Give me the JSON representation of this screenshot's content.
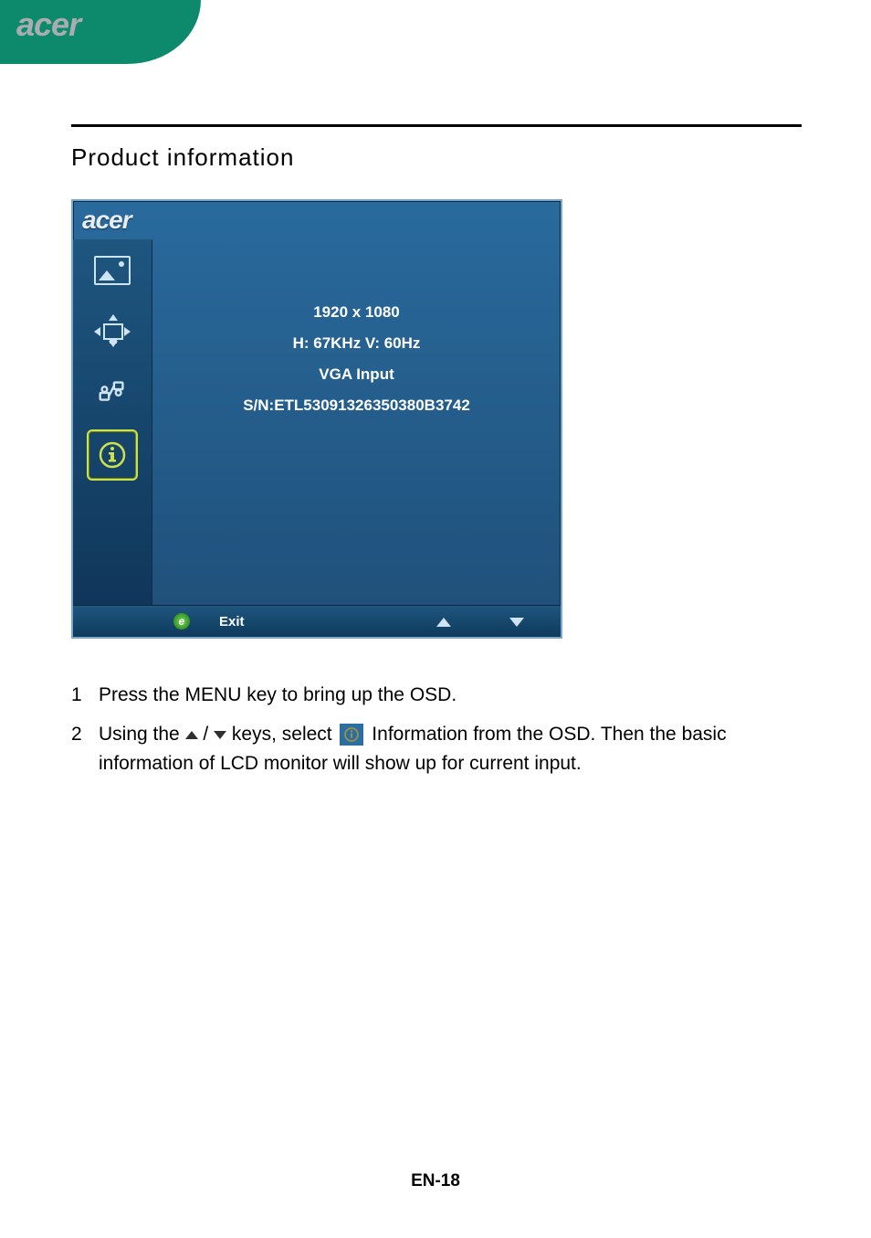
{
  "header": {
    "brand": "acer"
  },
  "section_title": "Product  information",
  "osd": {
    "brand": "acer",
    "info": {
      "resolution": "1920 x 1080",
      "frequency": "H: 67KHz   V: 60Hz",
      "input": "VGA Input",
      "serial": "S/N:ETL53091326350380B3742"
    },
    "footer": {
      "empower_label": "e",
      "exit_label": "Exit"
    }
  },
  "instructions": {
    "item1_num": "1",
    "item1_text": "Press the MENU key to bring up the OSD.",
    "item2_num": "2",
    "item2_a": "Using the ",
    "item2_slash": " / ",
    "item2_b": " keys, select ",
    "item2_c": " Information from the OSD. Then the basic information of LCD monitor will show up for current input."
  },
  "page_number": "EN-18"
}
